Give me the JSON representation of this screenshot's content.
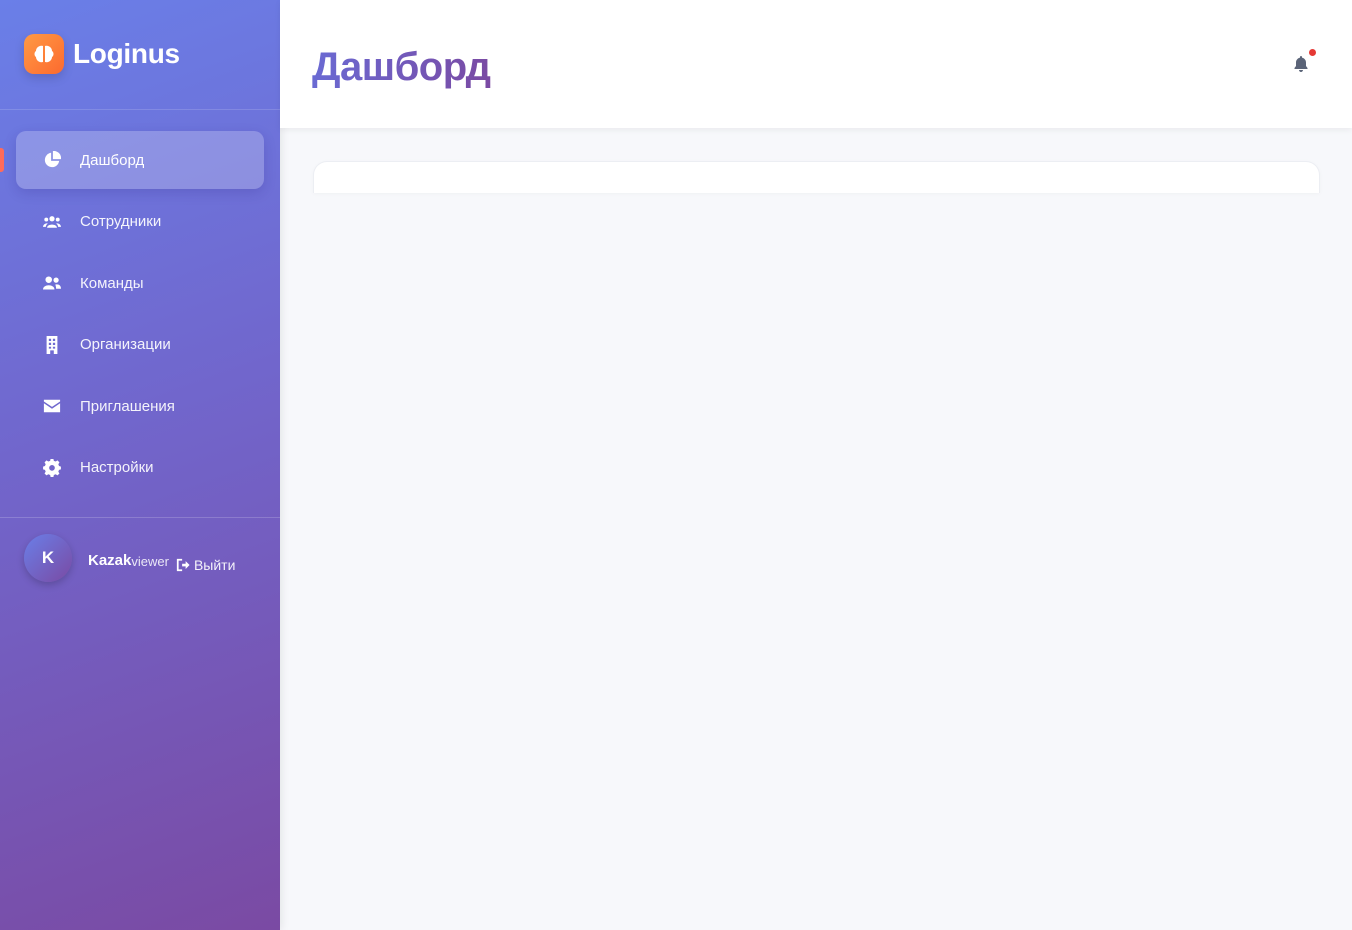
{
  "brand": {
    "name": "Loginus",
    "logo_icon": "brain-icon",
    "logo_color": "#fc7a36"
  },
  "sidebar": {
    "items": [
      {
        "label": "Дашборд",
        "icon": "pie-chart-icon",
        "active": true
      },
      {
        "label": "Сотрудники",
        "icon": "users-icon",
        "active": false
      },
      {
        "label": "Команды",
        "icon": "user-group-icon",
        "active": false
      },
      {
        "label": "Организации",
        "icon": "building-icon",
        "active": false
      },
      {
        "label": "Приглашения",
        "icon": "envelope-icon",
        "active": false
      },
      {
        "label": "Настройки",
        "icon": "gear-icon",
        "active": false
      }
    ],
    "accent_marker_color": "#ff6b5a"
  },
  "user": {
    "initial": "K",
    "name": "Kazak",
    "role": "viewer",
    "logout_label": "Выйти"
  },
  "header": {
    "title": "Дашборд",
    "notification_icon": "bell-icon",
    "has_unread": true
  },
  "colors": {
    "sidebar_gradient_start": "#6a7fe8",
    "sidebar_gradient_end": "#7a4aa3",
    "badge": "#e53935",
    "page_background": "#f7f8fb"
  }
}
